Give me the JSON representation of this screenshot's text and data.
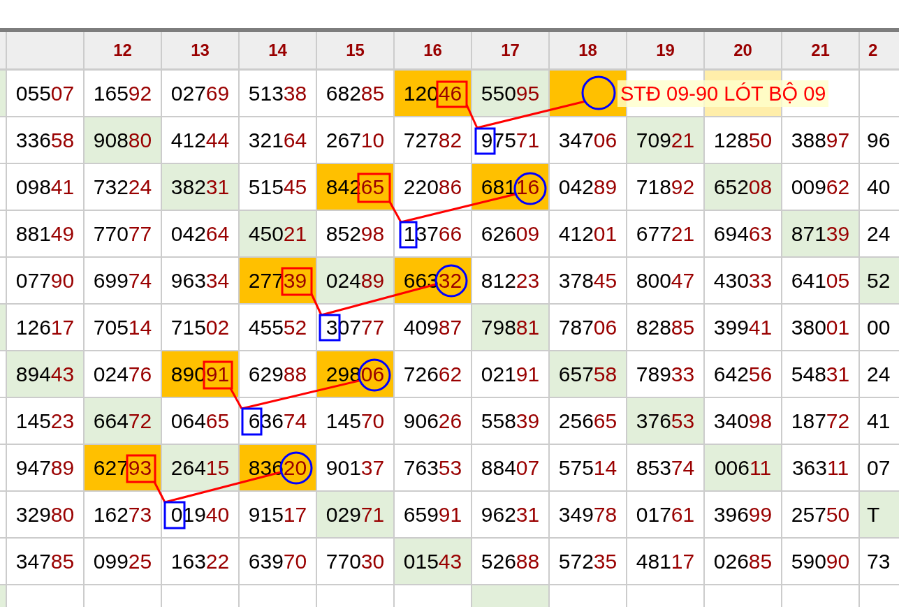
{
  "header": {
    "columns": [
      "12",
      "13",
      "14",
      "15",
      "16",
      "17",
      "18",
      "19",
      "20",
      "21",
      "2"
    ]
  },
  "rows": [
    {
      "edge": {
        "color": "#e2efda"
      },
      "cells": [
        {
          "digits": "055",
          "last_two": "07"
        },
        {
          "digits": "165",
          "last_two": "92"
        },
        {
          "digits": "027",
          "last_two": "69"
        },
        {
          "digits": "513",
          "last_two": "38"
        },
        {
          "digits": "682",
          "last_two": "85"
        },
        {
          "digits": "120",
          "last_two": "46",
          "color": "#ffc000"
        },
        {
          "digits": "550",
          "last_two": "95",
          "color": "#e2efda"
        },
        {
          "color": "#ffc000"
        },
        {},
        {
          "color": "#ffeeaa"
        },
        {},
        {}
      ]
    },
    {
      "cells": [
        {
          "digits": "336",
          "last_two": "58"
        },
        {
          "digits": "908",
          "last_two": "80",
          "color": "#e2efda"
        },
        {
          "digits": "412",
          "last_two": "44"
        },
        {
          "digits": "321",
          "last_two": "64"
        },
        {
          "digits": "267",
          "last_two": "10"
        },
        {
          "digits": "727",
          "last_two": "82"
        },
        {
          "digits": "975",
          "last_two": "71"
        },
        {
          "digits": "347",
          "last_two": "06"
        },
        {
          "digits": "709",
          "last_two": "21",
          "color": "#e2efda"
        },
        {
          "digits": "128",
          "last_two": "50"
        },
        {
          "digits": "388",
          "last_two": "97"
        },
        {
          "digits": "96"
        }
      ]
    },
    {
      "cells": [
        {
          "digits": "098",
          "last_two": "41"
        },
        {
          "digits": "732",
          "last_two": "24"
        },
        {
          "digits": "382",
          "last_two": "31",
          "color": "#e2efda"
        },
        {
          "digits": "515",
          "last_two": "45"
        },
        {
          "digits": "842",
          "last_two": "65",
          "color": "#ffc000"
        },
        {
          "digits": "220",
          "last_two": "86"
        },
        {
          "digits": "681",
          "last_two": "16",
          "color": "#ffc000"
        },
        {
          "digits": "042",
          "last_two": "89"
        },
        {
          "digits": "718",
          "last_two": "92"
        },
        {
          "digits": "652",
          "last_two": "08",
          "color": "#e2efda"
        },
        {
          "digits": "009",
          "last_two": "62"
        },
        {
          "digits": "40"
        }
      ]
    },
    {
      "cells": [
        {
          "digits": "881",
          "last_two": "49"
        },
        {
          "digits": "770",
          "last_two": "77"
        },
        {
          "digits": "042",
          "last_two": "64"
        },
        {
          "digits": "450",
          "last_two": "21",
          "color": "#e2efda"
        },
        {
          "digits": "852",
          "last_two": "98"
        },
        {
          "digits": "137",
          "last_two": "66"
        },
        {
          "digits": "626",
          "last_two": "09"
        },
        {
          "digits": "412",
          "last_two": "01"
        },
        {
          "digits": "677",
          "last_two": "21"
        },
        {
          "digits": "694",
          "last_two": "63"
        },
        {
          "digits": "871",
          "last_two": "39",
          "color": "#e2efda"
        },
        {
          "digits": "24"
        }
      ]
    },
    {
      "cells": [
        {
          "digits": "077",
          "last_two": "90"
        },
        {
          "digits": "699",
          "last_two": "74"
        },
        {
          "digits": "963",
          "last_two": "34"
        },
        {
          "digits": "277",
          "last_two": "39",
          "color": "#ffc000"
        },
        {
          "digits": "024",
          "last_two": "89",
          "color": "#e2efda"
        },
        {
          "digits": "663",
          "last_two": "32",
          "color": "#ffc000"
        },
        {
          "digits": "812",
          "last_two": "23"
        },
        {
          "digits": "378",
          "last_two": "45"
        },
        {
          "digits": "800",
          "last_two": "47"
        },
        {
          "digits": "430",
          "last_two": "33"
        },
        {
          "digits": "641",
          "last_two": "05"
        },
        {
          "digits": "52",
          "color": "#e2efda"
        }
      ]
    },
    {
      "edge": {
        "color": "#e2efda"
      },
      "cells": [
        {
          "digits": "126",
          "last_two": "17"
        },
        {
          "digits": "705",
          "last_two": "14"
        },
        {
          "digits": "715",
          "last_two": "02"
        },
        {
          "digits": "455",
          "last_two": "52"
        },
        {
          "digits": "307",
          "last_two": "77"
        },
        {
          "digits": "409",
          "last_two": "87"
        },
        {
          "digits": "798",
          "last_two": "81",
          "color": "#e2efda"
        },
        {
          "digits": "787",
          "last_two": "06"
        },
        {
          "digits": "828",
          "last_two": "85"
        },
        {
          "digits": "399",
          "last_two": "41"
        },
        {
          "digits": "380",
          "last_two": "01"
        },
        {
          "digits": "00"
        }
      ]
    },
    {
      "cells": [
        {
          "digits": "894",
          "last_two": "43",
          "color": "#e2efda"
        },
        {
          "digits": "024",
          "last_two": "76"
        },
        {
          "digits": "890",
          "last_two": "91",
          "color": "#ffc000"
        },
        {
          "digits": "629",
          "last_two": "88"
        },
        {
          "digits": "298",
          "last_two": "06",
          "color": "#ffc000"
        },
        {
          "digits": "726",
          "last_two": "62"
        },
        {
          "digits": "021",
          "last_two": "91"
        },
        {
          "digits": "657",
          "last_two": "58",
          "color": "#e2efda"
        },
        {
          "digits": "789",
          "last_two": "33"
        },
        {
          "digits": "642",
          "last_two": "56"
        },
        {
          "digits": "548",
          "last_two": "31"
        },
        {
          "digits": "24"
        }
      ]
    },
    {
      "cells": [
        {
          "digits": "145",
          "last_two": "23"
        },
        {
          "digits": "664",
          "last_two": "72",
          "color": "#e2efda"
        },
        {
          "digits": "064",
          "last_two": "65"
        },
        {
          "digits": "636",
          "last_two": "74"
        },
        {
          "digits": "145",
          "last_two": "70"
        },
        {
          "digits": "906",
          "last_two": "26"
        },
        {
          "digits": "558",
          "last_two": "39"
        },
        {
          "digits": "256",
          "last_two": "65"
        },
        {
          "digits": "376",
          "last_two": "53",
          "color": "#e2efda"
        },
        {
          "digits": "340",
          "last_two": "98"
        },
        {
          "digits": "187",
          "last_two": "72"
        },
        {
          "digits": "41"
        }
      ]
    },
    {
      "cells": [
        {
          "digits": "947",
          "last_two": "89"
        },
        {
          "digits": "627",
          "last_two": "93",
          "color": "#ffc000"
        },
        {
          "digits": "264",
          "last_two": "15",
          "color": "#e2efda"
        },
        {
          "digits": "836",
          "last_two": "20",
          "color": "#ffc000"
        },
        {
          "digits": "901",
          "last_two": "37"
        },
        {
          "digits": "763",
          "last_two": "53"
        },
        {
          "digits": "884",
          "last_two": "07"
        },
        {
          "digits": "575",
          "last_two": "14"
        },
        {
          "digits": "853",
          "last_two": "74"
        },
        {
          "digits": "006",
          "last_two": "11",
          "color": "#e2efda"
        },
        {
          "digits": "363",
          "last_two": "11"
        },
        {
          "digits": "07"
        }
      ]
    },
    {
      "cells": [
        {
          "digits": "329",
          "last_two": "80"
        },
        {
          "digits": "162",
          "last_two": "73"
        },
        {
          "digits": "019",
          "last_two": "40"
        },
        {
          "digits": "915",
          "last_two": "17"
        },
        {
          "digits": "029",
          "last_two": "71",
          "color": "#e2efda"
        },
        {
          "digits": "659",
          "last_two": "91"
        },
        {
          "digits": "962",
          "last_two": "31"
        },
        {
          "digits": "349",
          "last_two": "78"
        },
        {
          "digits": "017",
          "last_two": "61"
        },
        {
          "digits": "396",
          "last_two": "99"
        },
        {
          "digits": "257",
          "last_two": "50"
        },
        {
          "digits": "T",
          "color": "#e2efda"
        }
      ]
    },
    {
      "cells": [
        {
          "digits": "347",
          "last_two": "85"
        },
        {
          "digits": "099",
          "last_two": "25"
        },
        {
          "digits": "163",
          "last_two": "22"
        },
        {
          "digits": "639",
          "last_two": "70"
        },
        {
          "digits": "770",
          "last_two": "30"
        },
        {
          "digits": "015",
          "last_two": "43",
          "color": "#e2efda"
        },
        {
          "digits": "526",
          "last_two": "88"
        },
        {
          "digits": "572",
          "last_two": "35"
        },
        {
          "digits": "481",
          "last_two": "17"
        },
        {
          "digits": "026",
          "last_two": "85"
        },
        {
          "digits": "590",
          "last_two": "90"
        },
        {
          "digits": "73"
        }
      ]
    },
    {
      "edge": {
        "color": "#e2efda"
      },
      "cells": [
        {},
        {},
        {},
        {},
        {},
        {},
        {
          "color": "#e2efda"
        },
        {},
        {},
        {},
        {},
        {}
      ]
    }
  ],
  "annotation": {
    "text": "STĐ 09-90 LÓT BỘ 09"
  }
}
